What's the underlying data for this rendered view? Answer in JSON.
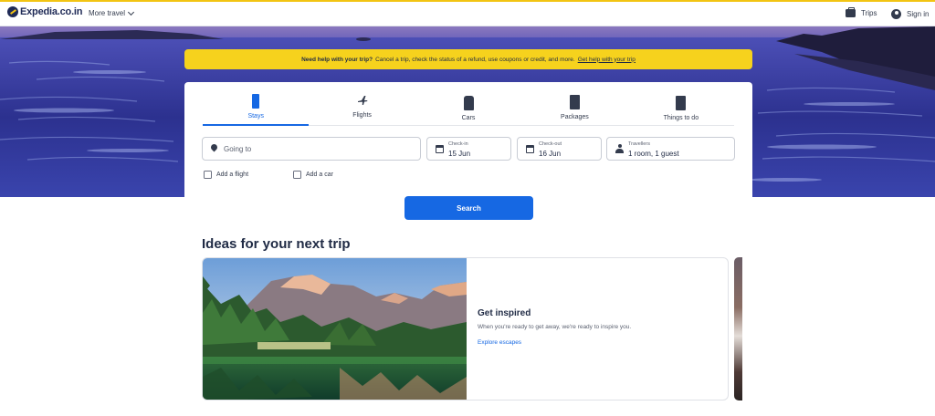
{
  "header": {
    "logo_text": "Expedia.co.in",
    "more_travel": "More travel",
    "trips": "Trips",
    "sign_in": "Sign in"
  },
  "notice": {
    "bold": "Need help with your trip?",
    "text": "Cancel a trip, check the status of a refund, use coupons or credit, and more.",
    "link": "Get help with your trip"
  },
  "tabs": [
    {
      "label": "Stays",
      "icon": "stays-icon",
      "active": true
    },
    {
      "label": "Flights",
      "icon": "plane-icon",
      "active": false
    },
    {
      "label": "Cars",
      "icon": "car-icon",
      "active": false
    },
    {
      "label": "Packages",
      "icon": "packages-icon",
      "active": false
    },
    {
      "label": "Things to do",
      "icon": "ticket-icon",
      "active": false
    }
  ],
  "search": {
    "going_to_placeholder": "Going to",
    "checkin_label": "Check-in",
    "checkin_value": "15 Jun",
    "checkout_label": "Check-out",
    "checkout_value": "16 Jun",
    "travellers_label": "Travellers",
    "travellers_value": "1 room, 1 guest",
    "add_flight": "Add a flight",
    "add_car": "Add a car",
    "button": "Search"
  },
  "ideas": {
    "title": "Ideas for your next trip",
    "card_title": "Get inspired",
    "card_text": "When you're ready to get away, we're ready to inspire you.",
    "card_link": "Explore escapes"
  },
  "colors": {
    "brand_blue": "#1668e3",
    "notice_yellow": "#f6d21d",
    "navy": "#1f2a56"
  }
}
